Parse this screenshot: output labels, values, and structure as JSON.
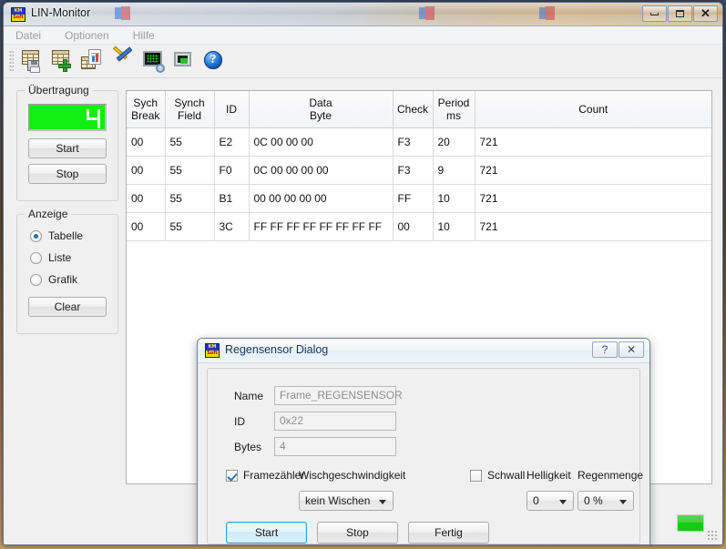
{
  "window": {
    "title": "LIN-Monitor",
    "icon": "kmsoft-logo-icon",
    "buttons": {
      "minimize": "minimize-icon",
      "maximize": "maximize-icon",
      "close": "✕"
    }
  },
  "menubar": {
    "items": [
      {
        "label": "Datei"
      },
      {
        "label": "Optionen"
      },
      {
        "label": "Hilfe"
      }
    ]
  },
  "toolbar": {
    "items": [
      {
        "name": "save-table-icon"
      },
      {
        "name": "add-table-icon"
      },
      {
        "name": "report-document-icon"
      },
      {
        "name": "tools-settings-icon"
      },
      {
        "name": "scope-config-icon"
      },
      {
        "name": "chip-monitor-icon"
      },
      {
        "name": "help-icon",
        "glyph": "?"
      }
    ]
  },
  "sidebar": {
    "transmission": {
      "title": "Übertragung",
      "lcd_value": "4",
      "lcd_color": "#12ed12",
      "start_label": "Start",
      "stop_label": "Stop"
    },
    "display": {
      "title": "Anzeige",
      "options": [
        {
          "label": "Tabelle",
          "checked": true
        },
        {
          "label": "Liste",
          "checked": false
        },
        {
          "label": "Grafik",
          "checked": false
        }
      ],
      "clear_label": "Clear"
    }
  },
  "table": {
    "columns": [
      {
        "line1": "Sych",
        "line2": "Break"
      },
      {
        "line1": "Synch",
        "line2": "Field"
      },
      {
        "line1": "ID",
        "line2": ""
      },
      {
        "line1": "Data",
        "line2": "Byte"
      },
      {
        "line1": "Check",
        "line2": ""
      },
      {
        "line1": "Period",
        "line2": "ms"
      },
      {
        "line1": "Count",
        "line2": ""
      }
    ],
    "rows": [
      {
        "sych_break": "00",
        "synch_field": "55",
        "id": "E2",
        "data_byte": "0C 00 00 00",
        "check": "F3",
        "period_ms": "20",
        "count": "721"
      },
      {
        "sych_break": "00",
        "synch_field": "55",
        "id": "F0",
        "data_byte": "0C 00 00 00 00",
        "check": "F3",
        "period_ms": "9",
        "count": "721"
      },
      {
        "sych_break": "00",
        "synch_field": "55",
        "id": "B1",
        "data_byte": "00 00 00 00 00",
        "check": "FF",
        "period_ms": "10",
        "count": "721"
      },
      {
        "sych_break": "00",
        "synch_field": "55",
        "id": "3C",
        "data_byte": "FF FF FF FF FF FF FF FF",
        "check": "00",
        "period_ms": "10",
        "count": "721"
      }
    ]
  },
  "dialog": {
    "title": "Regensensor Dialog",
    "icon": "kmsoft-logo-icon",
    "help_button": "?",
    "close_button": "✕",
    "fields": [
      {
        "label": "Name",
        "value": "Frame_REGENSENSOR"
      },
      {
        "label": "ID",
        "value": "0x22"
      },
      {
        "label": "Bytes",
        "value": "4"
      }
    ],
    "framezaehler": {
      "label": "Framezähler",
      "checked": true
    },
    "schwall": {
      "label": "Schwall",
      "checked": false
    },
    "wischgeschwindigkeit": {
      "label": "Wischgeschwindigkeit",
      "value": "kein Wischen"
    },
    "helligkeit": {
      "label": "Helligkeit",
      "value": "0"
    },
    "regenmenge": {
      "label": "Regenmenge",
      "value": "0 %"
    },
    "buttons": {
      "start": "Start",
      "stop": "Stop",
      "fertig": "Fertig"
    }
  },
  "statusbar": {
    "led_color": "#12cc12"
  }
}
